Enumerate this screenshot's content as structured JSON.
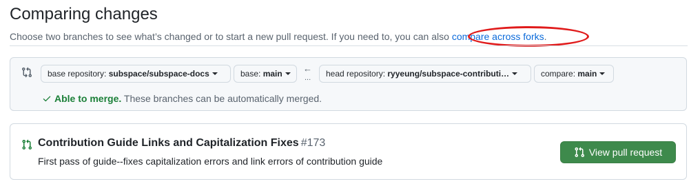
{
  "header": {
    "title": "Comparing changes",
    "subtitle_text": "Choose two branches to see what’s changed or to start a new pull request. If you need to, you can also ",
    "subtitle_link": "compare across forks",
    "subtitle_end": "."
  },
  "compare": {
    "base_repo_label": "base repository: ",
    "base_repo_value": "subspace/subspace-docs",
    "base_label": "base: ",
    "base_value": "main",
    "arrow": "←",
    "dots": "...",
    "head_repo_label": "head repository: ",
    "head_repo_value": "ryyeung/subspace-contributi…",
    "compare_label": "compare: ",
    "compare_value": "main",
    "merge_status": "Able to merge.",
    "merge_message": " These branches can be automatically merged."
  },
  "pull_request": {
    "title": "Contribution Guide Links and Capitalization Fixes",
    "number": "#173",
    "description": "First pass of guide--fixes capitalization errors and link errors of contribution guide",
    "view_button": "View pull request"
  },
  "colors": {
    "link": "#0969da",
    "success": "#1a7f37",
    "button_green": "#3e8a4c",
    "annotation": "#e01b1b"
  }
}
